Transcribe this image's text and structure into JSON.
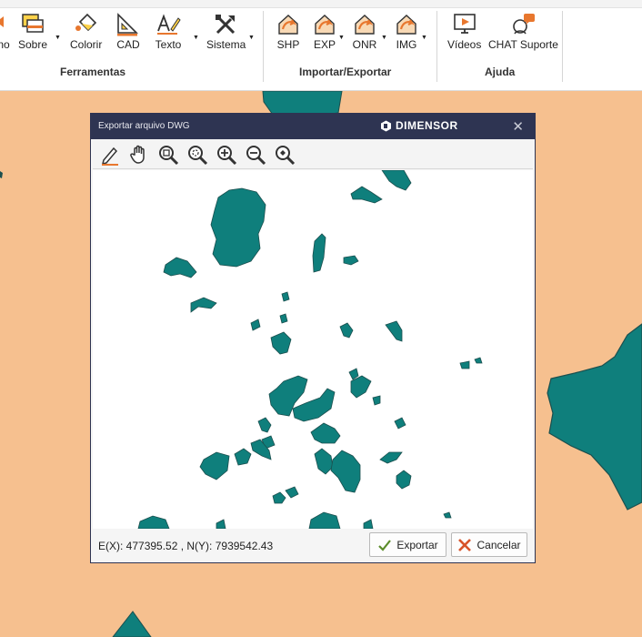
{
  "ribbon": {
    "partial_label": "no",
    "buttons": {
      "sobre": "Sobre",
      "colorir": "Colorir",
      "cad": "CAD",
      "texto": "Texto",
      "sistema": "Sistema",
      "shp": "SHP",
      "exp": "EXP",
      "onr": "ONR",
      "img": "IMG",
      "videos": "Vídeos",
      "chat": "CHAT Suporte"
    },
    "groups": {
      "ferramentas": "Ferramentas",
      "importar": "Importar/Exportar",
      "ajuda": "Ajuda"
    }
  },
  "dialog": {
    "title": "Exportar arquivo DWG",
    "brand": "DIMENSOR",
    "close": "✕",
    "tools": [
      "pencil-icon",
      "pan-hand-icon",
      "zoom-window-icon",
      "zoom-extents-icon",
      "zoom-in-icon",
      "zoom-out-icon",
      "zoom-previous-icon"
    ],
    "status": "E(X): 477395.52 , N(Y): 7939542.43",
    "export_label": "Exportar",
    "cancel_label": "Cancelar"
  },
  "colors": {
    "map_background": "#f6c08f",
    "polygon_fill": "#0f7f7c",
    "dialog_frame": "#2e3452",
    "crosshair": "#e07a3a"
  }
}
